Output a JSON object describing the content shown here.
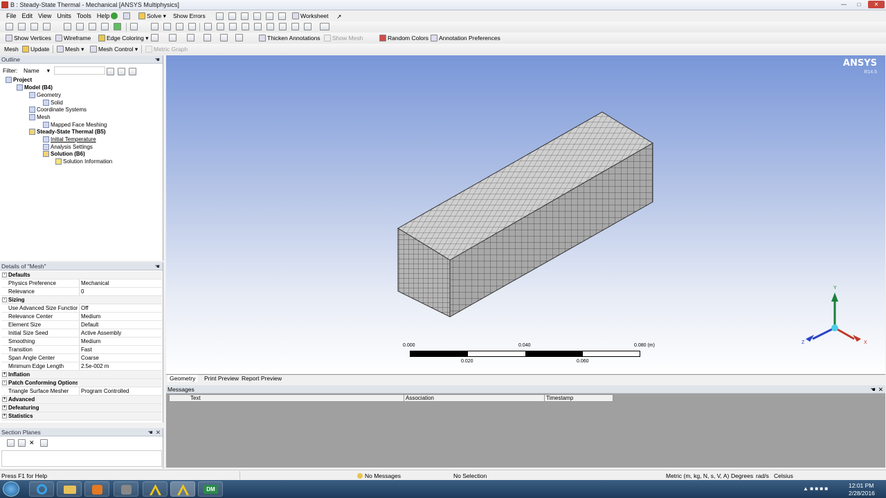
{
  "window": {
    "title": "B : Steady-State Thermal - Mechanical [ANSYS Multiphysics]"
  },
  "menu": [
    "File",
    "Edit",
    "View",
    "Units",
    "Tools",
    "Help"
  ],
  "toolbar1": {
    "solve": "Solve",
    "show_errors": "Show Errors",
    "worksheet": "Worksheet"
  },
  "toolbar2": {
    "show_vertices": "Show Vertices",
    "wireframe": "Wireframe",
    "edge_coloring": "Edge Coloring",
    "thicken_annotations": "Thicken Annotations",
    "show_mesh": "Show Mesh",
    "random_colors": "Random Colors",
    "annotation_preferences": "Annotation Preferences"
  },
  "toolbar3": {
    "mesh_label": "Mesh",
    "update": "Update",
    "mesh_menu": "Mesh",
    "mesh_control": "Mesh Control",
    "metric_graph": "Metric Graph"
  },
  "outline": {
    "title": "Outline",
    "filter_label": "Filter:",
    "filter_value": "Name",
    "tree": [
      {
        "label": "Project",
        "bold": true
      },
      {
        "label": "Model (B4)",
        "bold": true
      },
      {
        "label": "Geometry",
        "bold": false
      },
      {
        "label": "Solid",
        "bold": false
      },
      {
        "label": "Coordinate Systems",
        "bold": false
      },
      {
        "label": "Mesh",
        "bold": false
      },
      {
        "label": "Mapped Face Meshing",
        "bold": false
      },
      {
        "label": "Steady-State Thermal (B5)",
        "bold": true
      },
      {
        "label": "Initial Temperature",
        "bold": false
      },
      {
        "label": "Analysis Settings",
        "bold": false
      },
      {
        "label": "Solution (B6)",
        "bold": true
      },
      {
        "label": "Solution Information",
        "bold": false
      }
    ]
  },
  "details": {
    "title": "Details of \"Mesh\"",
    "rows": [
      {
        "k": "Defaults",
        "v": "",
        "grp": true
      },
      {
        "k": "Physics Preference",
        "v": "Mechanical"
      },
      {
        "k": "Relevance",
        "v": "0"
      },
      {
        "k": "Sizing",
        "v": "",
        "grp": true
      },
      {
        "k": "Use Advanced Size Function",
        "v": "Off"
      },
      {
        "k": "Relevance Center",
        "v": "Medium"
      },
      {
        "k": "Element Size",
        "v": "Default"
      },
      {
        "k": "Initial Size Seed",
        "v": "Active Assembly"
      },
      {
        "k": "Smoothing",
        "v": "Medium"
      },
      {
        "k": "Transition",
        "v": "Fast"
      },
      {
        "k": "Span Angle Center",
        "v": "Coarse"
      },
      {
        "k": "Minimum Edge Length",
        "v": "2.5e-002 m"
      },
      {
        "k": "Inflation",
        "v": "",
        "grp": true
      },
      {
        "k": "Patch Conforming Options",
        "v": "",
        "grp": true
      },
      {
        "k": "Triangle Surface Mesher",
        "v": "Program Controlled"
      },
      {
        "k": "Advanced",
        "v": "",
        "grp": true
      },
      {
        "k": "Defeaturing",
        "v": "",
        "grp": true
      },
      {
        "k": "Statistics",
        "v": "",
        "grp": true
      }
    ]
  },
  "section_planes": {
    "title": "Section Planes"
  },
  "viewport": {
    "brand": "ANSYS",
    "version": "R14.5",
    "scale": {
      "t0": "0.000",
      "t1": "0.040",
      "t2": "0.080 (m)",
      "b1": "0.020",
      "b2": "0.060"
    },
    "axes": {
      "x": "X",
      "y": "Y",
      "z": "Z"
    }
  },
  "view_tabs": [
    "Geometry",
    "Print Preview",
    "Report Preview"
  ],
  "messages": {
    "title": "Messages",
    "columns": [
      "Text",
      "Association",
      "Timestamp"
    ]
  },
  "status": {
    "help": "Press F1 for Help",
    "messages": "No Messages",
    "selection": "No Selection",
    "units": "Metric (m, kg, N, s, V, A)",
    "deg": "Degrees",
    "rads": "rad/s",
    "temp": "Celsius"
  },
  "clock": {
    "time": "12:01 PM",
    "date": "2/28/2016"
  },
  "taskbar": {
    "dm": "DM"
  }
}
